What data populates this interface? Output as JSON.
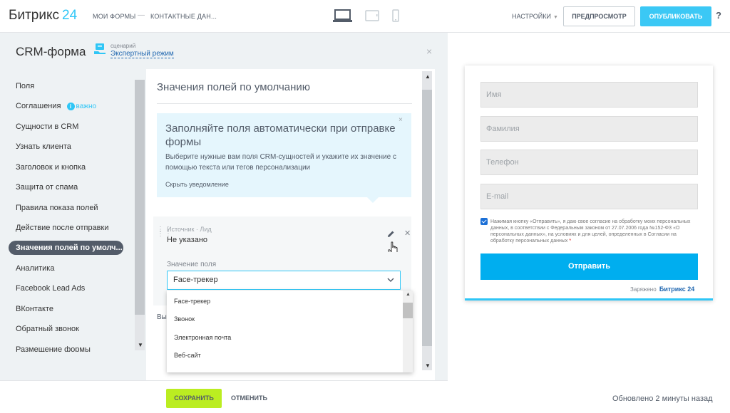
{
  "header": {
    "logo_text": "Битрикс",
    "logo_num": "24",
    "crumbs": [
      "МОИ ФОРМЫ",
      "КОНТАКТНЫЕ ДАН..."
    ],
    "crumb_separator": "—",
    "devices": [
      "desktop-icon",
      "tablet-icon",
      "mobile-icon"
    ],
    "settings_label": "НАСТРОЙКИ",
    "preview_label": "ПРЕДПРОСМОТР",
    "publish_label": "ОПУБЛИКОВАТЬ",
    "help_label": "?"
  },
  "panel": {
    "title": "CRM-форма",
    "scenario_label": "сценарий",
    "scenario_value": "Экспертный режим",
    "close_label": "×"
  },
  "nav": {
    "items": [
      {
        "label": "Поля"
      },
      {
        "label": "Соглашения",
        "badge": "важно"
      },
      {
        "label": "Сущности в CRM"
      },
      {
        "label": "Узнать клиента"
      },
      {
        "label": "Заголовок и кнопка"
      },
      {
        "label": "Защита от спама"
      },
      {
        "label": "Правила показа полей"
      },
      {
        "label": "Действие после отправки"
      },
      {
        "label": "Значения полей по умолч..."
      },
      {
        "label": "Аналитика"
      },
      {
        "label": "Facebook Lead Ads"
      },
      {
        "label": "ВКонтакте"
      },
      {
        "label": "Обратный звонок"
      },
      {
        "label": "Размещение формы"
      }
    ],
    "active_index": 8
  },
  "content": {
    "title": "Значения полей по умолчанию",
    "notice": {
      "title": "Заполняйте поля автоматически при отправке формы",
      "text": "Выберите нужные вам поля CRM-сущностей и укажите их значение с помощью текста или тегов персонализации",
      "link": "Скрыть уведомление",
      "close": "×"
    },
    "source_label": "Источник · Лид",
    "source_value": "Не указано",
    "value_label": "Значение поля",
    "select_value": "Face-трекер",
    "options": [
      "Face-трекер",
      "Звонок",
      "Электронная почта",
      "Веб-сайт"
    ],
    "partial_text": "Вы"
  },
  "footer": {
    "save_label": "СОХРАНИТЬ",
    "cancel_label": "ОТМЕНИТЬ"
  },
  "preview": {
    "fields": [
      "Имя",
      "Фамилия",
      "Телефон",
      "E-mail"
    ],
    "consent_text": "Нажимая кнопку «Отправить», я даю свое согласие на обработку моих персональных данных, в соответствии с Федеральным законом от 27.07.2006 года №152-ФЗ «О персональных данных», на условиях и для целей, определенных в Согласии на обработку персональных данных",
    "consent_required_mark": "*",
    "submit_label": "Отправить",
    "powered_text": "Заряжено",
    "powered_brand": "Битрикс",
    "powered_num": "24",
    "updated_text": "Обновлено 2 минуты назад"
  },
  "colors": {
    "accent": "#2fc6f6",
    "publish": "#3bc8f5",
    "save": "#bbed21",
    "submit": "#00aeef",
    "active_nav": "#535c69"
  }
}
